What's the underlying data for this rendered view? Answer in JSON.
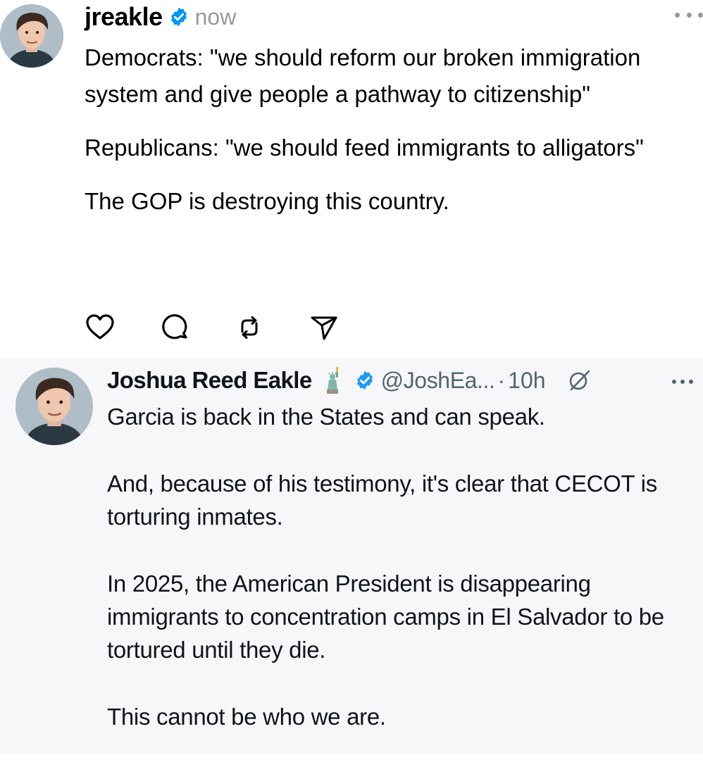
{
  "top_post": {
    "username": "jreakle",
    "time": "now",
    "verified": true,
    "paragraphs": [
      "Democrats: \"we should reform our broken immigration system and give people a pathway to citizenship\"",
      "Republicans: \"we should feed immigrants to alligators\"",
      "The GOP is destroying this country."
    ],
    "actions": [
      "heart-icon",
      "comment-icon",
      "repost-icon",
      "share-icon"
    ]
  },
  "quoted_post": {
    "display_name": "Joshua Reed Eakle",
    "name_emoji": "statue-of-liberty-icon",
    "verified": true,
    "handle": "@JoshEa...",
    "separator": "·",
    "time": "10h",
    "paragraphs": [
      "Garcia is back in the States and can speak.",
      "And, because of his testimony, it's clear that CECOT is torturing inmates.",
      "In 2025, the American President is disappearing immigrants to concentration camps in El Salvador to be tortured until they die.",
      "This cannot be who we are."
    ]
  },
  "colors": {
    "verified_blue": "#1d9bf0",
    "threads_verified": "#0095f6",
    "muted_text": "#999999",
    "x_muted_text": "#536471",
    "quote_background": "#f7f7f9"
  }
}
